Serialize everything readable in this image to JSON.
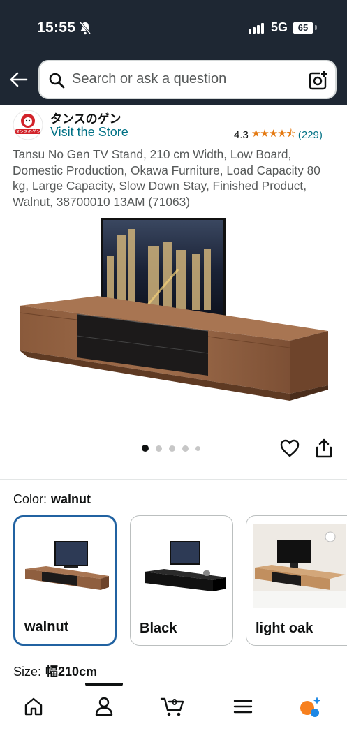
{
  "status_bar": {
    "time": "15:55",
    "network": "5G",
    "battery": "65"
  },
  "search": {
    "placeholder": "Search or ask a question"
  },
  "store": {
    "name": "タンスのゲン",
    "link": "Visit the Store",
    "rating": "4.3",
    "rating_count": "(229)",
    "stars": "★★★★⯪",
    "logo_text": "タンスのゲン"
  },
  "product": {
    "title": "Tansu No Gen TV Stand, 210 cm Width, Low Board, Domestic Production, Okawa Furniture, Load Capacity 80 kg, Large Capacity, Slow Down Stay, Finished Product, Walnut, 38700010 13AM (71063)",
    "image_count": 5,
    "active_image": 1
  },
  "color": {
    "label": "Color:",
    "selected": "walnut",
    "options": [
      {
        "label": "walnut",
        "selected": true
      },
      {
        "label": "Black",
        "selected": false
      },
      {
        "label": "light oak",
        "selected": false
      }
    ]
  },
  "size": {
    "label": "Size:",
    "selected": "幅210cm"
  },
  "nav": {
    "items": [
      "home-icon",
      "account-icon",
      "cart-icon",
      "menu-icon",
      "rufus-icon"
    ],
    "cart_count": "0",
    "active": "account"
  },
  "colors": {
    "header": "#1e2733",
    "link": "#007185",
    "star": "#e47911",
    "selected_border": "#2162a1"
  }
}
